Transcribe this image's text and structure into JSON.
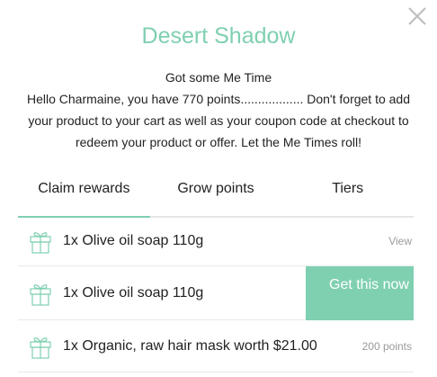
{
  "modal": {
    "title": "Desert Shadow",
    "intro_line1": "Got some Me Time",
    "intro_line2": "Hello Charmaine, you have 770 points.................. Don't forget to add your product to your cart as well as your coupon code at checkout to redeem your product or offer. Let the Me Times roll!"
  },
  "tabs": [
    {
      "label": "Claim rewards",
      "active": true
    },
    {
      "label": "Grow points",
      "active": false
    },
    {
      "label": "Tiers",
      "active": false
    }
  ],
  "rewards": [
    {
      "name": "1x Olive oil soap 110g",
      "action": "View"
    },
    {
      "name": "1x Olive oil soap 110g",
      "action": "Get this now"
    },
    {
      "name": "1x Organic, raw hair mask worth $21.00",
      "action": "200 points"
    }
  ],
  "colors": {
    "accent": "#7fd0b0",
    "muted_text": "#9a9a9a",
    "divider": "#e9e9e9"
  },
  "icons": {
    "close": "close-icon",
    "gift": "gift-icon"
  }
}
